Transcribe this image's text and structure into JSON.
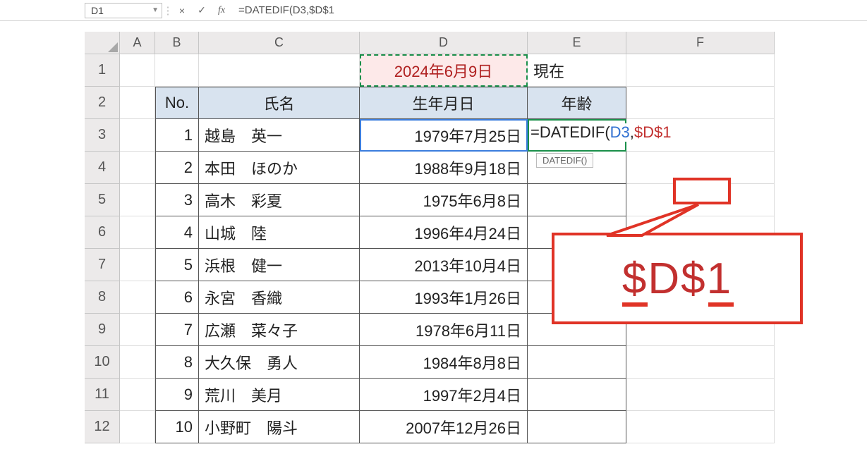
{
  "formula_bar": {
    "cell_ref": "D1",
    "cancel_icon": "×",
    "confirm_icon": "✓",
    "fx_label": "fx",
    "formula_text": "=DATEDIF(D3,$D$1"
  },
  "columns": [
    "A",
    "B",
    "C",
    "D",
    "E",
    "F"
  ],
  "rows": [
    "1",
    "2",
    "3",
    "4",
    "5",
    "6",
    "7",
    "8",
    "9",
    "10",
    "11",
    "12"
  ],
  "cells": {
    "D1": "2024年6月9日",
    "E1": "現在",
    "B2": "No.",
    "C2": "氏名",
    "D2": "生年月日",
    "E2": "年齢"
  },
  "formula_inline": {
    "prefix": "=DATEDIF(",
    "arg1": "D3",
    "sep": ",",
    "arg2": "$D$1",
    "tooltip": "DATEDIF()"
  },
  "table_rows": [
    {
      "no": "1",
      "name": "越島　英一",
      "dob": "1979年7月25日"
    },
    {
      "no": "2",
      "name": "本田　ほのか",
      "dob": "1988年9月18日"
    },
    {
      "no": "3",
      "name": "高木　彩夏",
      "dob": "1975年6月8日"
    },
    {
      "no": "4",
      "name": "山城　陸",
      "dob": "1996年4月24日"
    },
    {
      "no": "5",
      "name": "浜根　健一",
      "dob": "2013年10月4日"
    },
    {
      "no": "6",
      "name": "永宮　香織",
      "dob": "1993年1月26日"
    },
    {
      "no": "7",
      "name": "広瀬　菜々子",
      "dob": "1978年6月11日"
    },
    {
      "no": "8",
      "name": "大久保　勇人",
      "dob": "1984年8月8日"
    },
    {
      "no": "9",
      "name": "荒川　美月",
      "dob": "1997年2月4日"
    },
    {
      "no": "10",
      "name": "小野町　陽斗",
      "dob": "2007年12月26日"
    }
  ],
  "callout": {
    "big_text": "$D$1"
  }
}
